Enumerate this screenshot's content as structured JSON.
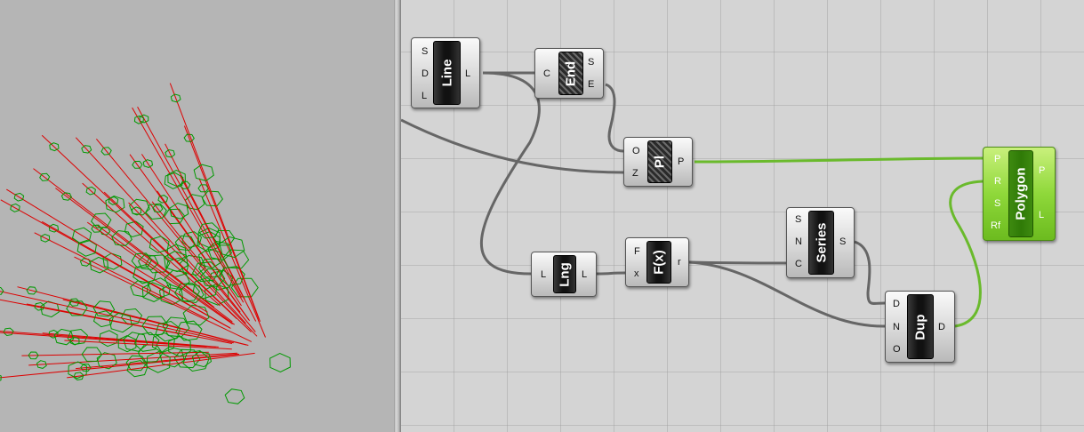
{
  "colors": {
    "viewport_bg": "#b5b5b5",
    "canvas_bg": "#d4d4d4",
    "wire": "#666666",
    "wire_selected": "#6aba2c",
    "line_geometry": "#dd0000",
    "polygon_geometry": "#009900"
  },
  "components": {
    "line": {
      "title": "Line",
      "inputs": [
        "S",
        "D",
        "L"
      ],
      "outputs": [
        "L"
      ]
    },
    "end": {
      "title": "End",
      "inputs": [
        "C"
      ],
      "outputs": [
        "S",
        "E"
      ]
    },
    "pl": {
      "title": "Pl",
      "inputs": [
        "O",
        "Z"
      ],
      "outputs": [
        "P"
      ]
    },
    "polygon": {
      "title": "Polygon",
      "inputs": [
        "P",
        "R",
        "S",
        "Rf"
      ],
      "outputs": [
        "P",
        "L"
      ]
    },
    "lng": {
      "title": "Lng",
      "inputs": [
        "L"
      ],
      "outputs": [
        "L"
      ]
    },
    "fx": {
      "title": "F(x)",
      "inputs": [
        "F",
        "x"
      ],
      "outputs": [
        "r"
      ]
    },
    "series": {
      "title": "Series",
      "inputs": [
        "S",
        "N",
        "C"
      ],
      "outputs": [
        "S"
      ]
    },
    "dup": {
      "title": "Dup",
      "inputs": [
        "D",
        "N",
        "O"
      ],
      "outputs": [
        "D"
      ]
    }
  }
}
